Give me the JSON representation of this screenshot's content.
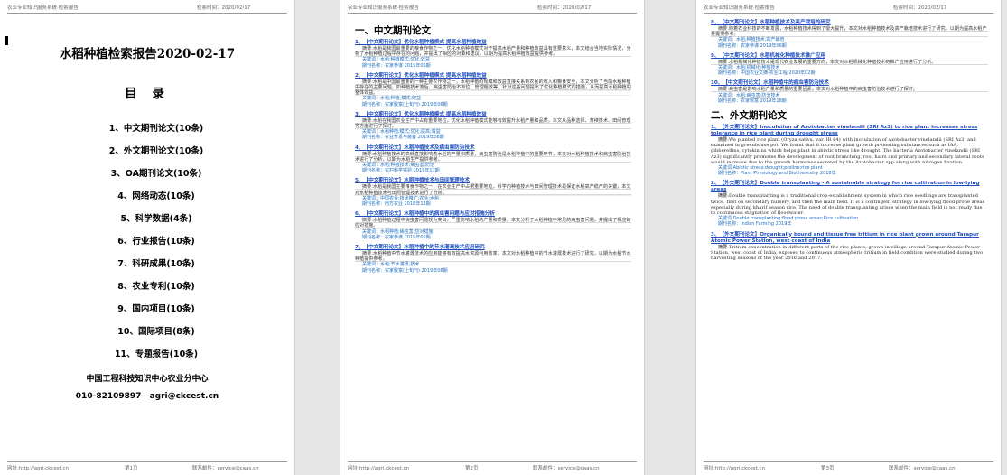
{
  "header": {
    "left": "农业专业知识服务系统·检索报告",
    "right": "检索时间：2020/02/17"
  },
  "footer": {
    "left": "网址:http://agri.ckcest.cn",
    "page1": "第1页",
    "page2": "第2页",
    "page3": "第3页",
    "right": "联系邮件：service@caas.cn"
  },
  "cover": {
    "title": "水稻种植检索报告2020-02-17",
    "toc_title": "目 录",
    "toc": [
      "1、中文期刊论文(10条)",
      "2、外文期刊论文(10条)",
      "3、OA期刊论文(10条)",
      "4、网络动态(10条)",
      "5、科学数据(4条)",
      "6、行业报告(10条)",
      "7、科研成果(10条)",
      "8、农业专利(10条)",
      "9、国内项目(10条)",
      "10、国际项目(8条)",
      "11、专题报告(10条)"
    ],
    "org": "中国工程科技知识中心农业分中心",
    "phone": "010-82109897",
    "email": "agri@ckcest.cn"
  },
  "page2": {
    "section": "一、中文期刊论文",
    "articles": [
      {
        "title": "1、【中文期刊论文】优化水稻种植模式 提高水稻种植效益",
        "body": "摘要:水稻是我国最重要的粮食作物之一，优化水稻种植模式对于提高水稻产量和种植效益具有重要意义，本文结合当地实际情况，分析了水稻种植过程中存在的问题，并提出了相应的对策和建议，以期为提高水稻种植效益提供参考。",
        "kw": "关键词：水稻;种植模式;优化;效益",
        "src": "期刊名称：农家参谋          2019年05期"
      },
      {
        "title": "2、【中文期刊论文】优化水稻种植模式 提高水稻种植效益",
        "body": "摘要:水稻是中国最重要的一种主要农作物之一，水稻种植的规模和效益直接关系到农民的收入和粮食安全，本文分析了当前水稻种植中存在的主要问题，如种植技术落后、病虫害防治不到位、管理粗放等，针对这些问题提出了优化种植模式的措施，从而提高水稻种植的整体效益。",
        "kw": "关键词：水稻;种植;模式;效益",
        "src": "期刊名称：农家致富(上旬刊)         2019年06期"
      },
      {
        "title": "3、【中文期刊论文】优化水稻种植模式 提高水稻种植效益",
        "body": "摘要:水稻在我国农业生产中占有重要地位，优化水稻种植模式能够有效提升水稻产量和品质，本文从品种选择、育秧技术、田间管理等方面进行了探讨。",
        "kw": "关键词：水稻种植;模式;优化;提高;效益",
        "src": "期刊名称：农业开发与装备        2019年08期"
      },
      {
        "title": "4、【中文期刊论文】水稻种植技术及病虫害防治技术",
        "body": "摘要:水稻种植技术的高低直接影响着水稻的产量和质量，病虫害防治是水稻种植中的重要环节，本文对水稻种植技术和病虫害防治技术进行了分析，以期为水稻生产提供参考。",
        "kw": "关键词：水稻;种植技术;病虫害;防治",
        "src": "期刊名称：农村科学实验          2019年17期"
      },
      {
        "title": "5、【中文期刊论文】水稻种植技术与田间管理技术",
        "body": "摘要:水稻是我国主要粮食作物之一，在农业生产中占据重要地位，科学的种植技术与田间管理技术是保证水稻高产稳产的关键，本文对水稻种植技术与田间管理技术进行了分析。",
        "kw": "关键词：中国农业;技术推广;农业;水稻",
        "src": "期刊名称：南方农业          2018年12期"
      },
      {
        "title": "6、【中文期刊论文】水稻种植中的病虫害问题与应对措施分析",
        "body": "摘要:水稻种植过程中病虫害问题较为突出，严重影响水稻的产量和质量，本文分析了水稻种植中常见的病虫害问题，并提出了相应的应对措施。",
        "kw": "关键词：水稻种植;病虫害;应对措施",
        "src": "期刊名称：农家参谋          2019年05期"
      },
      {
        "title": "7、【中文期刊论文】水稻种植中的节水灌溉技术应用研究",
        "body": "摘要:水稻种植中节水灌溉技术的应用能够有效提高水资源利用效率，本文对水稻种植中的节水灌溉技术进行了研究，以期为水稻节水种植提供参考。",
        "kw": "关键词：水稻;节水灌溉;技术",
        "src": "期刊名称：农家致富(上旬刊)         2019年08期"
      }
    ]
  },
  "page3": {
    "articles": [
      {
        "title": "8、【中文期刊论文】水稻种植技术及高产栽培的研究",
        "body": "摘要:随着农业科技的不断发展，水稻种植技术得到了很大提升，本文对水稻种植技术及高产栽培技术进行了研究，以期为提高水稻产量提供参考。",
        "kw": "关键词：水稻;种植技术;高产栽培",
        "src": "期刊名称：农家参谋          2019年06期"
      },
      {
        "title": "9、【中文期刊论文】水稻机械化种植技术推广应用",
        "body": "摘要:水稻机械化种植技术是现代农业发展的重要方向，本文对水稻机械化种植技术的推广应用进行了分析。",
        "kw": "关键词：水稻;机械化;种植技术",
        "src": "期刊名称：中国农业文摘-农业工程          2020年02期"
      },
      {
        "title": "10、【中文期刊论文】水稻种植中的病虫害防治技术",
        "body": "摘要:病虫害是影响水稻产量和质量的重要因素，本文对水稻种植中的病虫害防治技术进行了探讨。",
        "kw": "关键词：水稻;病虫害;防治技术",
        "src": "期刊名称：农家致富          2019年18期"
      }
    ],
    "section": "二、外文期刊论文",
    "foreign": [
      {
        "title": "1、【外文期刊论文】Inoculation of Azotobacter vinelandii (SRI Az3) to rice plant increases stress tolerance in rice plant during drought stress",
        "body": "摘要:We planted rice plant (Oryza sativa, var. IR 64) with inoculation of Azotobacter vinelandii (SRI Az3) and examined in greenhouse pot. We found that it increase plant growth promoting substances such as IAA, gibberellins, cytokinins which helps plant in abiotic stress like drought. The bacteria Azotobacter vinelandii (SRI Az3) significantly promotes the development of root branching, root hairs and primary and secondary lateral roots would increase due to the growth hormones secreted by the Azotobacter spp along with nitrogen fixation.",
        "kw": "关键词:Abiotic stress;drought;proline;rice plant",
        "src": "期刊名称：Plant Physiology and Biochemistry          2018年"
      },
      {
        "title": "2、【外文期刊论文】Double transplanting - A sustainable strategy for rice cultivation in low-lying areas",
        "body": "摘要:Double transplanting is a traditional crop-establishment system in which rice seedlings are transplanted twice, first on secondary nursery, and then the main field. It is a contingent strategy in low-lying flood prone areas especially during kharif season rice. The need of double transplanting arises when the main field is not ready due to continuous stagnation of floodwater.",
        "kw": "关键词:Double transplanting;flood prone areas;Rice cultivation",
        "src": "期刊名称：Indian Farming          2019年"
      },
      {
        "title": "3、【外文期刊论文】Organically bound and tissue free tritium in rice plant grown around Tarapur Atomic Power Station, west coast of India",
        "body": "摘要:Tritium concentration in different parts of the rice plants, grown in village around Tarapur Atomic Power Station, west coast of India, exposed to continuous atmospheric tritium in field condition were studied during two harvesting seasons of the year 2016 and 2017.",
        "kw": "",
        "src": ""
      }
    ]
  }
}
